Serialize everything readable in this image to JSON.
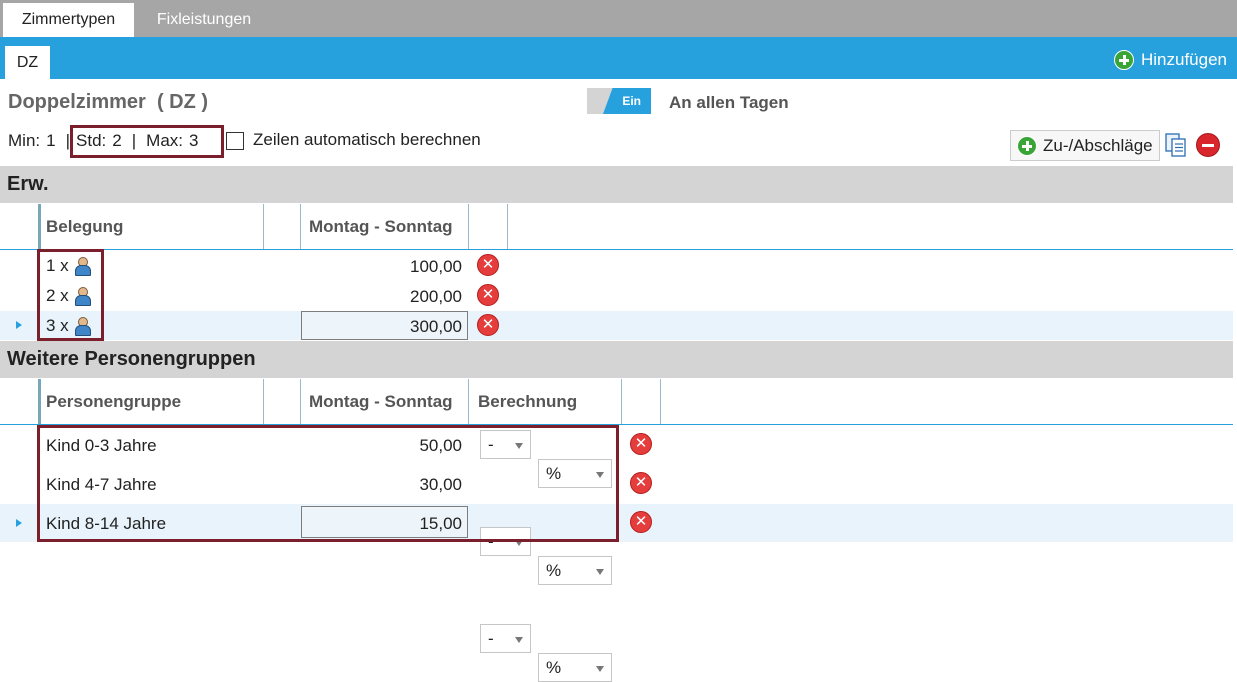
{
  "tabs": {
    "active": "Zimmertypen",
    "other": "Fixleistungen"
  },
  "subtab": "DZ",
  "add_label": "Hinzufügen",
  "room": {
    "name": "Doppelzimmer",
    "code": "( DZ )"
  },
  "toggle": {
    "state": "Ein",
    "label": "An allen Tagen"
  },
  "limits": {
    "min_label": "Min:",
    "min": "1",
    "sep": "|",
    "std_label": "Std:",
    "std": "2",
    "max_label": "Max:",
    "max": "3"
  },
  "auto_calc_label": "Zeilen automatisch berechnen",
  "toolbar": {
    "adjust_label": "Zu-/Abschläge"
  },
  "erw": {
    "title": "Erw.",
    "headers": {
      "occupancy": "Belegung",
      "days": "Montag - Sonntag"
    },
    "rows": [
      {
        "count": "1 x",
        "price": "100,00"
      },
      {
        "count": "2 x",
        "price": "200,00"
      },
      {
        "count": "3 x",
        "price": "300,00"
      }
    ]
  },
  "groups": {
    "title": "Weitere Personengruppen",
    "headers": {
      "group": "Personengruppe",
      "days": "Montag - Sonntag",
      "calc": "Berechnung"
    },
    "rows": [
      {
        "name": "Kind 0-3 Jahre",
        "price": "50,00",
        "op": "-",
        "unit": "%"
      },
      {
        "name": "Kind 4-7 Jahre",
        "price": "30,00",
        "op": "-",
        "unit": "%"
      },
      {
        "name": "Kind 8-14 Jahre",
        "price": "15,00",
        "op": "-",
        "unit": "%"
      }
    ]
  },
  "delete_symbol": "✕",
  "colors": {
    "accent": "#27a1de",
    "highlight": "#7a1f2b",
    "add_green": "#3aa537",
    "delete_red": "#e53c3c"
  }
}
